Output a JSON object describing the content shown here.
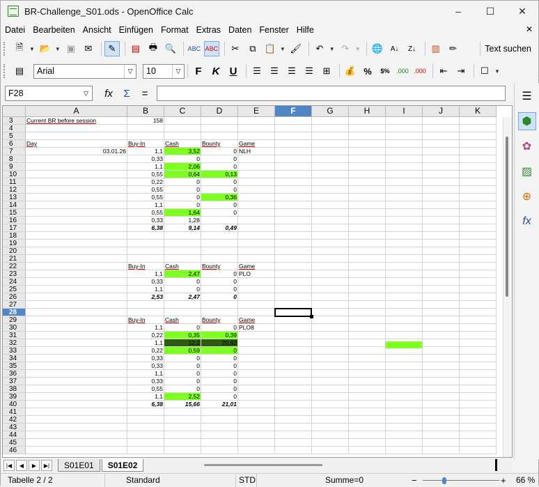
{
  "window": {
    "title": "BR-Challenge_S01.ods - OpenOffice Calc",
    "minimize": "–",
    "maximize": "☐",
    "close": "✕"
  },
  "menu": [
    "Datei",
    "Bearbeiten",
    "Ansicht",
    "Einfügen",
    "Format",
    "Extras",
    "Daten",
    "Fenster",
    "Hilfe"
  ],
  "menu_close": "✕",
  "toolbar": {
    "find_label": "Text suchen"
  },
  "format_toolbar": {
    "font": "Arial",
    "size": "10",
    "bold": "F",
    "italic": "K",
    "underline": "U"
  },
  "formula_bar": {
    "cell_ref": "F28",
    "formula": ""
  },
  "columns": [
    "A",
    "B",
    "C",
    "D",
    "E",
    "F",
    "G",
    "H",
    "I",
    "J",
    "K"
  ],
  "selected_column": "F",
  "selected_row": "28",
  "rows": [
    "3",
    "4",
    "5",
    "6",
    "7",
    "8",
    "9",
    "10",
    "11",
    "12",
    "13",
    "14",
    "15",
    "16",
    "17",
    "18",
    "19",
    "20",
    "21",
    "22",
    "23",
    "24",
    "25",
    "26",
    "27",
    "28",
    "29",
    "30",
    "31",
    "32",
    "33",
    "34",
    "35",
    "36",
    "37",
    "38",
    "39",
    "40",
    "41",
    "42",
    "43",
    "44",
    "45",
    "46"
  ],
  "cells": {
    "a3": "Current BR before session",
    "b3": "158",
    "a6": "Day",
    "b6": "Buy-In",
    "c6": "Cash",
    "d6": "Bounty",
    "e6": "Game",
    "a7": "03.01.26",
    "b7": "1,1",
    "c7": "3,52",
    "d7": "0",
    "e7": "NLH",
    "b8": "0,33",
    "c8": "0",
    "d8": "0",
    "b9": "1,1",
    "c9": "2,06",
    "d9": "0",
    "b10": "0,55",
    "c10": "0,64",
    "d10": "0,13",
    "b11": "0,22",
    "c11": "0",
    "d11": "0",
    "b12": "0,55",
    "c12": "0",
    "d12": "0",
    "b13": "0,55",
    "c13": "0",
    "d13": "0,36",
    "b14": "1,1",
    "c14": "0",
    "d14": "0",
    "b15": "0,55",
    "c15": "1,64",
    "d15": "0",
    "b16": "0,33",
    "c16": "1,28",
    "b17": "6,38",
    "c17": "9,14",
    "d17": "0,49",
    "b22": "Buy-In",
    "c22": "Cash",
    "d22": "Bounty",
    "e22": "Game",
    "b23": "1,1",
    "c23": "2,47",
    "d23": "0",
    "e23": "PLO",
    "b24": "0,33",
    "c24": "0",
    "d24": "0",
    "b25": "1,1",
    "c25": "0",
    "d25": "0",
    "b26": "2,53",
    "c26": "2,47",
    "d26": "0",
    "b29": "Buy-In",
    "c29": "Cash",
    "d29": "Bounty",
    "e29": "Game",
    "b30": "1,1",
    "c30": "0",
    "d30": "0",
    "e30": "PLO8",
    "b31": "0,22",
    "c31": "0,35",
    "d31": "0,39",
    "b32": "1,1",
    "c32": "12,2",
    "d32": "20,62",
    "b33": "0,22",
    "c33": "0,59",
    "d33": "0",
    "b34": "0,33",
    "c34": "0",
    "d34": "0",
    "b35": "0,33",
    "c35": "0",
    "d35": "0",
    "b36": "1,1",
    "c36": "0",
    "d36": "0",
    "b37": "0,33",
    "c37": "0",
    "d37": "0",
    "b38": "0,55",
    "c38": "0",
    "d38": "0",
    "b39": "1,1",
    "c39": "2,52",
    "d39": "0",
    "b40": "6,38",
    "c40": "15,66",
    "d40": "21,01"
  },
  "fill_colors": {
    "green": "#7fff22",
    "dark_green": "#2e5c0e",
    "selection": "#4f86c6"
  },
  "sheet_tabs": [
    "S01E01",
    "S01E02"
  ],
  "active_tab": "S01E02",
  "status": {
    "sheet": "Tabelle 2 / 2",
    "style": "Standard",
    "mode": "STD",
    "sum": "Summe=0",
    "zoom": "66 %",
    "zoom_minus": "−",
    "zoom_plus": "+"
  },
  "zoom_level": 66
}
